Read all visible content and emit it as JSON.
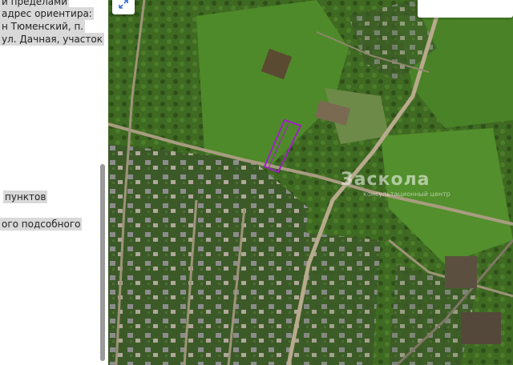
{
  "listing_text": {
    "line1": "и пределами",
    "line2": "адрес ориентира:",
    "line3": "н Тюменский, п.",
    "line4": "ул. Дачная, участок",
    "line5": "пунктов",
    "line6": "ого подсобного"
  },
  "watermark": {
    "brand": "Заскола",
    "sub": "консультационный центр"
  },
  "map_controls": {
    "expand_icon": "expand-arrows-icon"
  },
  "parcel": {
    "outline_color": "#a020c8"
  }
}
